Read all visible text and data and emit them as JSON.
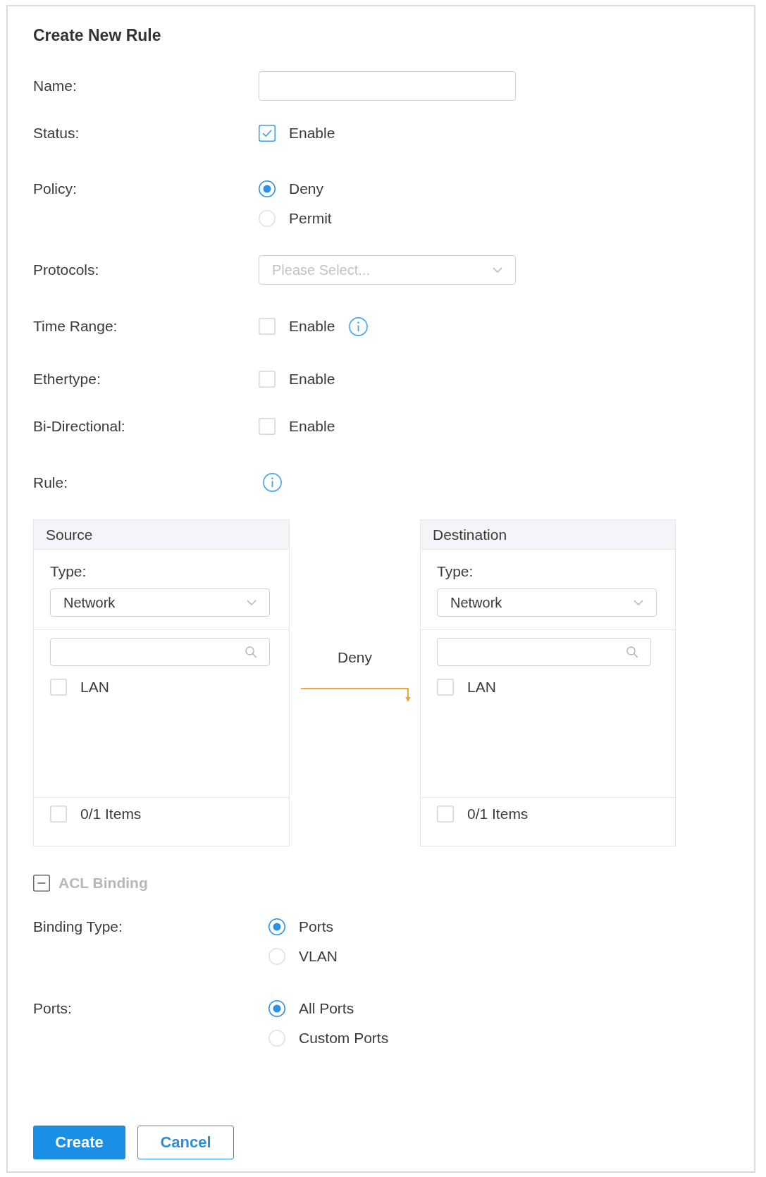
{
  "title": "Create New Rule",
  "fields": [
    {
      "kind": "text",
      "label": "Name:"
    },
    {
      "kind": "checkbox",
      "label": "Status:",
      "option": "Enable",
      "checked": true
    },
    {
      "kind": "radio",
      "label": "Policy:",
      "options": [
        {
          "label": "Deny",
          "selected": true
        },
        {
          "label": "Permit",
          "selected": false
        }
      ]
    },
    {
      "kind": "select",
      "label": "Protocols:",
      "placeholder": "Please Select..."
    },
    {
      "kind": "checkbox",
      "label": "Time Range:",
      "option": "Enable",
      "checked": false,
      "info": true
    },
    {
      "kind": "checkbox",
      "label": "Ethertype:",
      "option": "Enable",
      "checked": false
    },
    {
      "kind": "checkbox",
      "label": "Bi-Directional:",
      "option": "Enable",
      "checked": false
    },
    {
      "kind": "info",
      "label": "Rule:"
    }
  ],
  "rule": {
    "source": {
      "title": "Source",
      "type_label": "Type:",
      "type_value": "Network",
      "items": [
        {
          "label": "LAN",
          "checked": false
        }
      ],
      "footer": {
        "checked": false,
        "count": "0/1 Items"
      }
    },
    "action": "Deny",
    "destination": {
      "title": "Destination",
      "type_label": "Type:",
      "type_value": "Network",
      "items": [
        {
          "label": "LAN",
          "checked": false
        }
      ],
      "footer": {
        "checked": false,
        "count": "0/1 Items"
      }
    }
  },
  "acl_binding": {
    "title": "ACL Binding",
    "expanded": true,
    "fields": [
      {
        "kind": "radio",
        "label": "Binding Type:",
        "options": [
          {
            "label": "Ports",
            "selected": true
          },
          {
            "label": "VLAN",
            "selected": false
          }
        ]
      },
      {
        "kind": "radio",
        "label": "Ports:",
        "options": [
          {
            "label": "All Ports",
            "selected": true
          },
          {
            "label": "Custom Ports",
            "selected": false
          }
        ]
      }
    ]
  },
  "buttons": [
    {
      "kind": "primary",
      "label": "Create"
    },
    {
      "kind": "secondary",
      "label": "Cancel"
    }
  ]
}
